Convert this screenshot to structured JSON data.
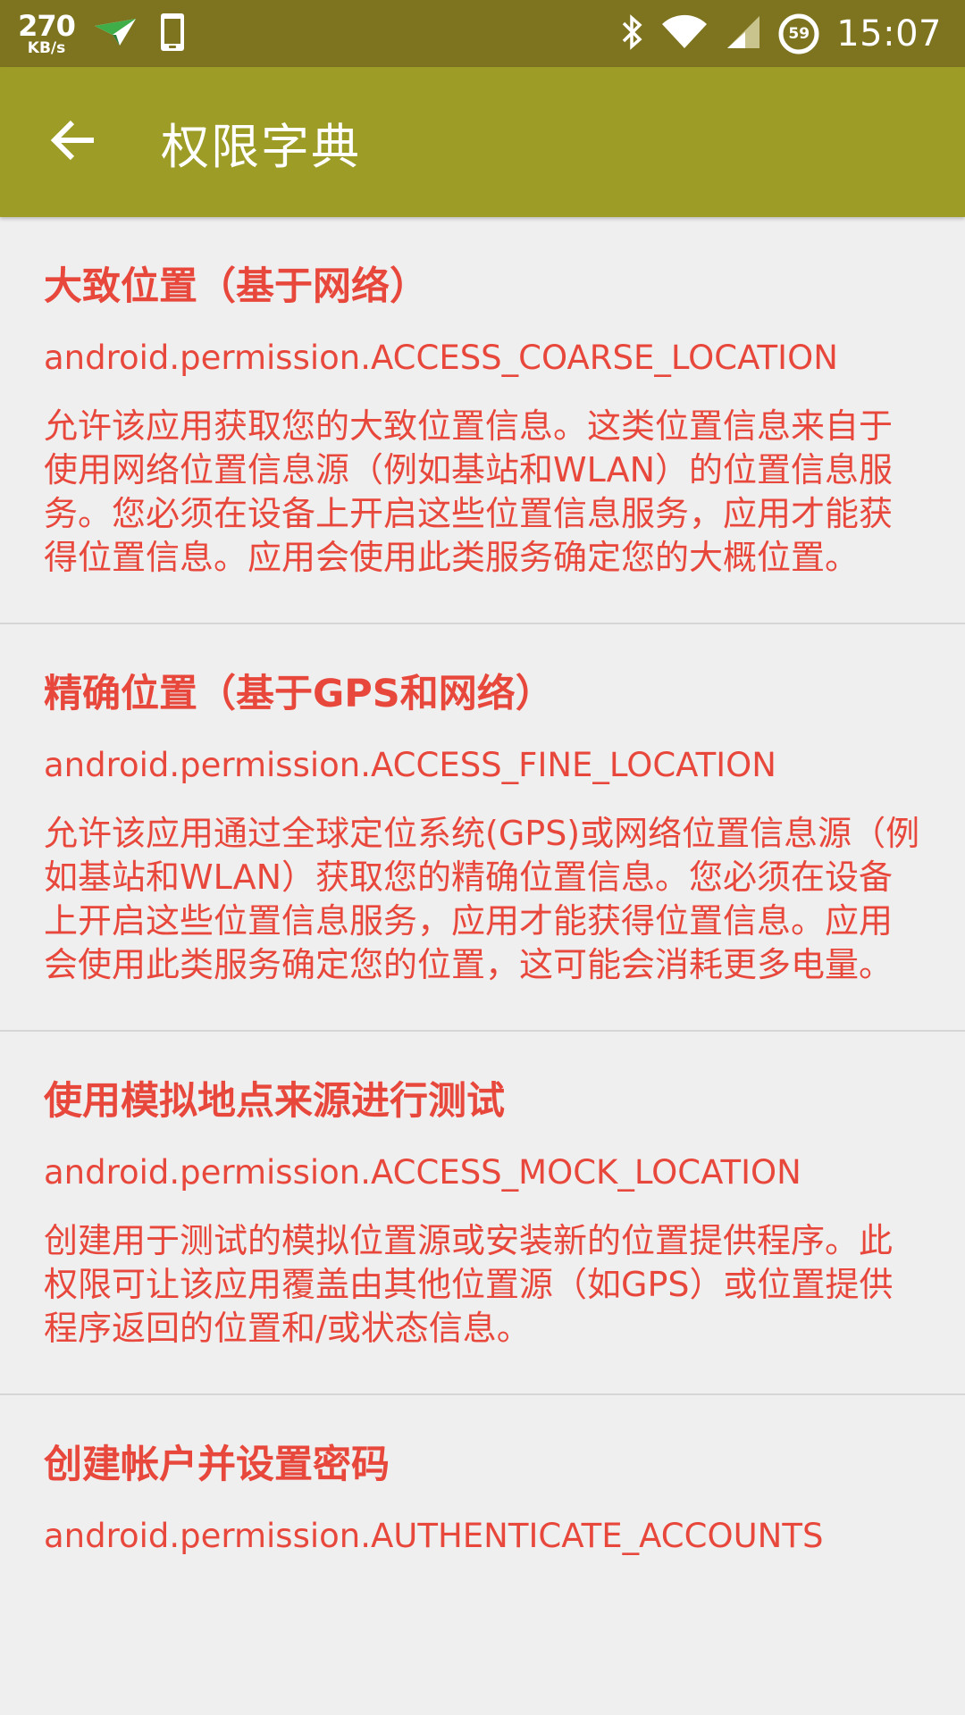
{
  "status_bar": {
    "net_speed_value": "270",
    "net_speed_unit": "KB/s",
    "battery_level": "59",
    "time": "15:07",
    "icons": [
      "paper-plane-icon",
      "phone-icon",
      "bluetooth-icon",
      "wifi-icon",
      "signal-icon",
      "battery-icon"
    ]
  },
  "app_bar": {
    "back_icon": "arrow-left-icon",
    "title": "权限字典",
    "color": "#9c9c26"
  },
  "accent_color": "#e8473c",
  "permissions": [
    {
      "title": "大致位置（基于网络）",
      "permission": "android.permission.ACCESS_COARSE_LOCATION",
      "description": "允许该应用获取您的大致位置信息。这类位置信息来自于使用网络位置信息源（例如基站和WLAN）的位置信息服务。您必须在设备上开启这些位置信息服务，应用才能获得位置信息。应用会使用此类服务确定您的大概位置。"
    },
    {
      "title": "精确位置（基于GPS和网络）",
      "permission": "android.permission.ACCESS_FINE_LOCATION",
      "description": "允许该应用通过全球定位系统(GPS)或网络位置信息源（例如基站和WLAN）获取您的精确位置信息。您必须在设备上开启这些位置信息服务，应用才能获得位置信息。应用会使用此类服务确定您的位置，这可能会消耗更多电量。"
    },
    {
      "title": "使用模拟地点来源进行测试",
      "permission": "android.permission.ACCESS_MOCK_LOCATION",
      "description": "创建用于测试的模拟位置源或安装新的位置提供程序。此权限可让该应用覆盖由其他位置源（如GPS）或位置提供程序返回的位置和/或状态信息。"
    },
    {
      "title": "创建帐户并设置密码",
      "permission": "android.permission.AUTHENTICATE_ACCOUNTS",
      "description": ""
    }
  ]
}
